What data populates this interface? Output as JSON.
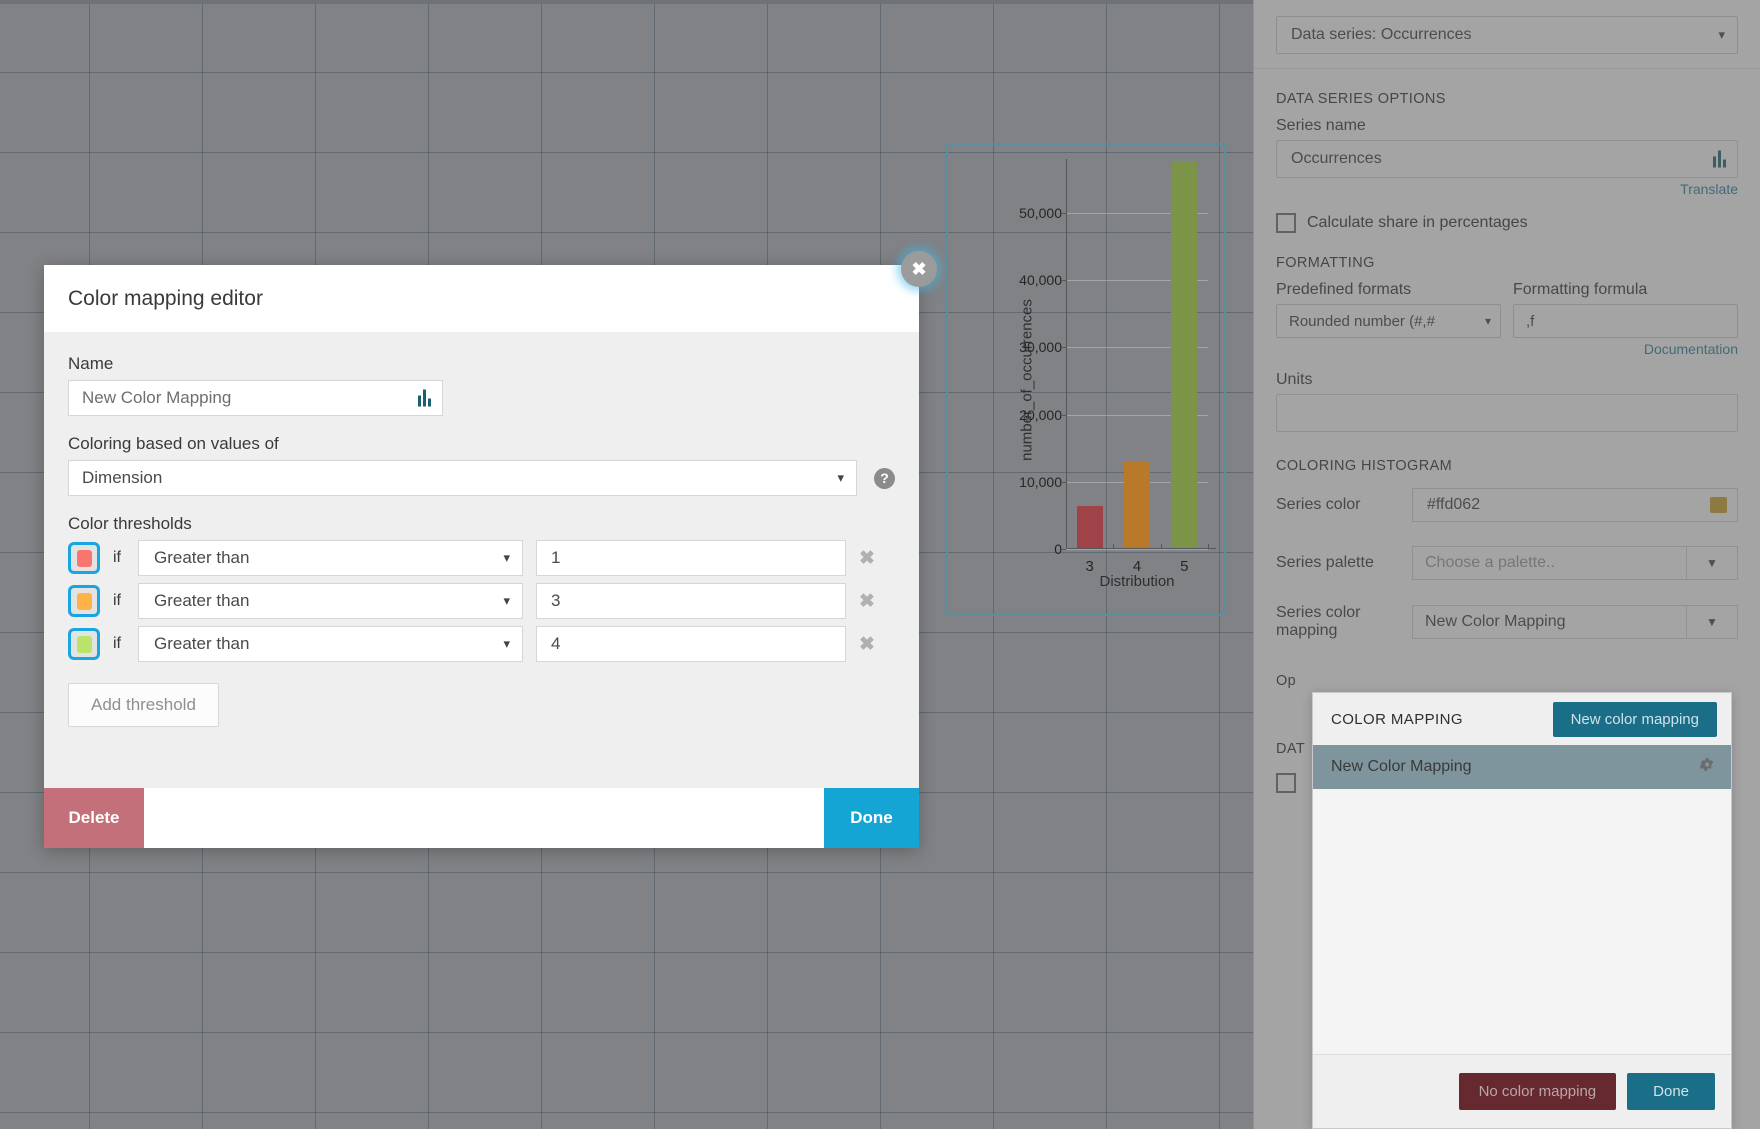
{
  "right_panel": {
    "series_selector": "Data series: Occurrences",
    "data_series_options": {
      "section_title": "DATA SERIES OPTIONS",
      "series_name_label": "Series name",
      "series_name_value": "Occurrences",
      "translate_link": "Translate",
      "calculate_share_label": "Calculate share in percentages"
    },
    "formatting": {
      "section_title": "FORMATTING",
      "predefined_formats_label": "Predefined formats",
      "predefined_formats_value": "Rounded number (#,#",
      "formatting_formula_label": "Formatting formula",
      "formatting_formula_value": ",f",
      "documentation_link": "Documentation",
      "units_label": "Units",
      "units_value": ""
    },
    "coloring_histogram": {
      "section_title": "COLORING HISTOGRAM",
      "series_color_label": "Series color",
      "series_color_value": "#ffd062",
      "series_color_swatch": "#c9a227",
      "series_palette_label": "Series palette",
      "series_palette_placeholder": "Choose a palette..",
      "series_color_mapping_label": "Series color mapping",
      "series_color_mapping_value": "New Color Mapping"
    },
    "obscured": {
      "options_partial": "Op",
      "data_partial": "DAT"
    }
  },
  "color_mapping_popup": {
    "title": "COLOR MAPPING",
    "new_button": "New color mapping",
    "items": [
      {
        "label": "New Color Mapping"
      }
    ],
    "no_mapping_button": "No color mapping",
    "done_button": "Done"
  },
  "modal": {
    "title": "Color mapping editor",
    "name_label": "Name",
    "name_value": "New Color Mapping",
    "coloring_label": "Coloring based on values of",
    "coloring_value": "Dimension",
    "thresholds_label": "Color thresholds",
    "if_text": "if",
    "thresholds": [
      {
        "color": "#f9766e",
        "operator": "Greater than",
        "value": "1"
      },
      {
        "color": "#ffb347",
        "operator": "Greater than",
        "value": "3"
      },
      {
        "color": "#b9e36a",
        "operator": "Greater than",
        "value": "4"
      }
    ],
    "add_threshold_label": "Add threshold",
    "delete_button": "Delete",
    "done_button": "Done"
  },
  "chart_data": {
    "type": "bar",
    "title": "",
    "categories": [
      "3",
      "4",
      "5"
    ],
    "values": [
      6200,
      12800,
      57500
    ],
    "colors": [
      "#a04348",
      "#b8792a",
      "#7b9448"
    ],
    "xlabel": "Distribution",
    "ylabel": "number_of_occurrences",
    "ylim": [
      0,
      58000
    ],
    "yticks": [
      0,
      10000,
      20000,
      30000,
      40000,
      50000
    ],
    "ytick_labels": [
      "0",
      "10,000",
      "20,000",
      "30,000",
      "40,000",
      "50,000"
    ],
    "grid": true,
    "legend": false
  }
}
